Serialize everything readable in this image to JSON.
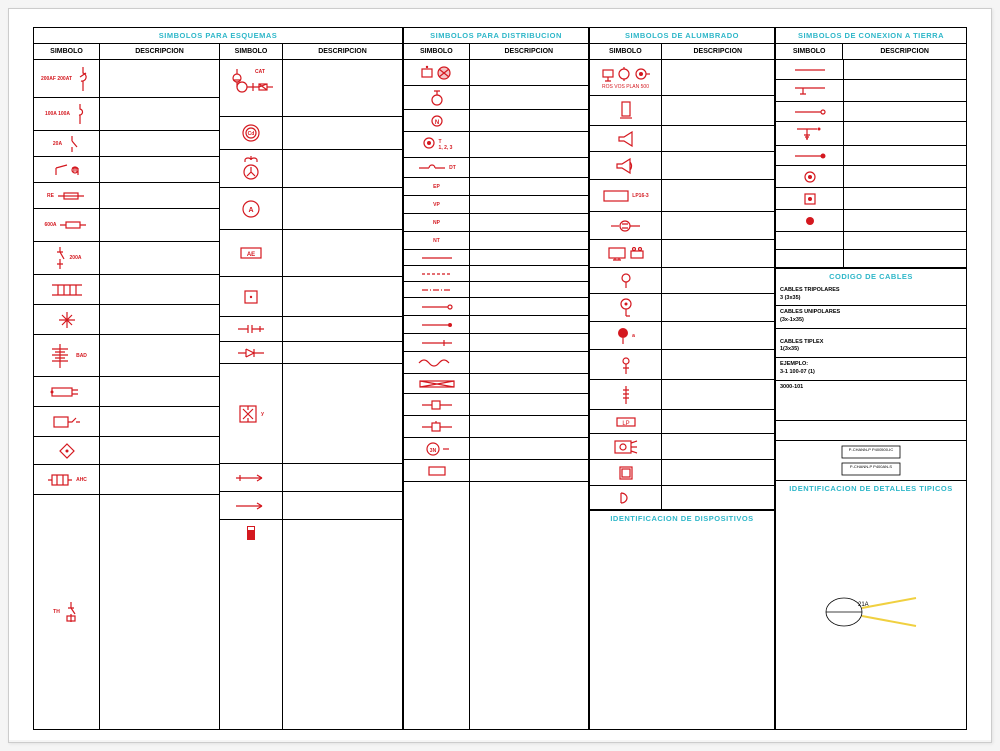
{
  "sections": {
    "esquemas": {
      "title": "SIMBOLOS PARA ESQUEMAS",
      "headers": [
        "SIMBOLO",
        "DESCRIPCION",
        "SIMBOLO",
        "DESCRIPCION"
      ]
    },
    "distribucion": {
      "title": "SIMBOLOS PARA DISTRIBUCION",
      "headers": [
        "SIMBOLO",
        "DESCRIPCION"
      ]
    },
    "alumbrado": {
      "title": "SIMBOLOS DE ALUMBRADO",
      "headers": [
        "SIMBOLO",
        "DESCRIPCION"
      ]
    },
    "tierra": {
      "title": "SIMBOLOS DE CONEXION A TIERRA",
      "headers": [
        "SIMBOLO",
        "DESCRIPCION"
      ]
    }
  },
  "subTitles": {
    "codigo": "CODIGO DE CABLES",
    "dispositivos": "IDENTIFICACION DE DISPOSITIVOS",
    "detalles": "IDENTIFICACION DE DETALLES TIPICOS"
  },
  "labels": {
    "esq1_1": "200AF\n200AT",
    "esq1_2": "100A\n100A",
    "esq1_3": "20A",
    "esq1_4": "RE",
    "esq1_5": "600A",
    "esq1_6": "200A",
    "esq1_7": "BAD",
    "esq1_8": "AHC",
    "esq2_1": "CAT",
    "esq2_2": "Cd",
    "esq2_3": "A",
    "esq2_4": "AE",
    "dist1": "N",
    "dist2": "DT",
    "dist3": "EP",
    "dist4": "VP",
    "dist5": "NP",
    "dist6": "NT",
    "dist7": "T\n1, 2, 3",
    "dist8": "3N",
    "alum1": "ROS VOS PLAN 500",
    "alum2": "LP16-3",
    "alum3": "LP",
    "cables1": "CABLES TRIPOLARES\n3 (3x35)",
    "cables2": "CABLES UNIPOLARES\n(3x-1x35)",
    "cables3": "CABLES TIPLEX\n1(3x35)",
    "cables4": "EJEMPLO:\n3-1 100-07 (1)",
    "cables5": "3000-101",
    "box1": "P-CHANN-P\nP400500-IC",
    "box2": "P-CHANN-P\nP400AN-S",
    "etiq": "21A"
  }
}
